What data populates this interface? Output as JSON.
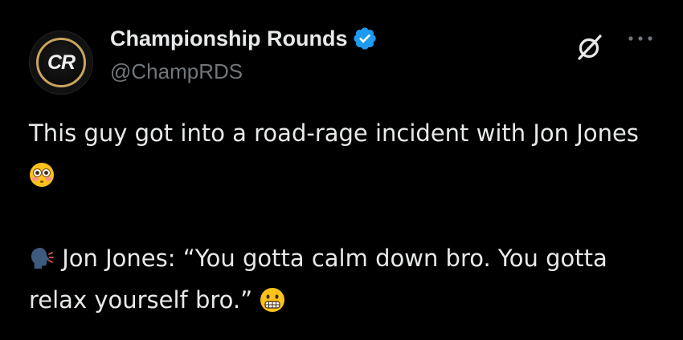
{
  "author": {
    "display_name": "Championship Rounds",
    "handle": "@ChampRDS",
    "avatar_text": "CR",
    "verified": true
  },
  "icons": {
    "verified": "verified-badge-icon",
    "grok": "grok-icon",
    "more": "more-options-icon"
  },
  "tweet": {
    "line1_text": "This guy got into a road-rage incident with Jon Jones",
    "line1_emoji": "flushed-face-emoji",
    "line2_text": "Jon Jones: “You gotta calm down bro. You gotta relax yourself bro.”",
    "line2_lead_emoji": "speaking-head-emoji",
    "line2_end_emoji": "grimacing-face-emoji"
  },
  "colors": {
    "background": "#000000",
    "text_primary": "#e7e9ea",
    "text_secondary": "#71767b",
    "verified_blue": "#1d9bf0",
    "avatar_gold": "#c9a45c"
  }
}
